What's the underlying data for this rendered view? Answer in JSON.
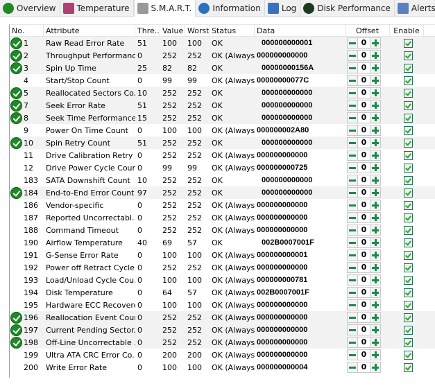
{
  "tabs": [
    {
      "label": "Overview",
      "icon": "check-circle-icon",
      "color": "#1e8a26"
    },
    {
      "label": "Temperature",
      "icon": "thermometer-icon",
      "color": "#b04070"
    },
    {
      "label": "S.M.A.R.T.",
      "icon": "disk-icon",
      "color": "#999999"
    },
    {
      "label": "Information",
      "icon": "info-icon",
      "color": "#2a6fc0"
    },
    {
      "label": "Log",
      "icon": "document-icon",
      "color": "#3a70c0"
    },
    {
      "label": "Disk Performance",
      "icon": "gauge-icon",
      "color": "#1e3a1e"
    },
    {
      "label": "Alerts",
      "icon": "alert-document-icon",
      "color": "#5a80c0"
    }
  ],
  "selected_tab": "S.M.A.R.T.",
  "columns": [
    "No.",
    "Attribute",
    "Thre...",
    "Value",
    "Worst",
    "Status",
    "Data",
    "Offset",
    "Enable"
  ],
  "rows": [
    {
      "ok": true,
      "no": "1",
      "attr": "Raw Read Error Rate",
      "thr": "51",
      "value": "100",
      "worst": "100",
      "status": "OK",
      "data": "000000000001",
      "offset": "0"
    },
    {
      "ok": true,
      "no": "2",
      "attr": "Throughput Performance",
      "thr": "0",
      "value": "252",
      "worst": "252",
      "status": "OK (Always...",
      "data": "000000000000",
      "offset": "0"
    },
    {
      "ok": true,
      "no": "3",
      "attr": "Spin Up Time",
      "thr": "25",
      "value": "82",
      "worst": "82",
      "status": "OK",
      "data": "00000000156A",
      "offset": "0"
    },
    {
      "ok": false,
      "no": "4",
      "attr": "Start/Stop Count",
      "thr": "0",
      "value": "99",
      "worst": "99",
      "status": "OK (Always...",
      "data": "00000000077C",
      "offset": "0"
    },
    {
      "ok": true,
      "no": "5",
      "attr": "Reallocated Sectors Co...",
      "thr": "10",
      "value": "252",
      "worst": "252",
      "status": "OK",
      "data": "000000000000",
      "offset": "0"
    },
    {
      "ok": true,
      "no": "7",
      "attr": "Seek Error Rate",
      "thr": "51",
      "value": "252",
      "worst": "252",
      "status": "OK",
      "data": "000000000000",
      "offset": "0"
    },
    {
      "ok": true,
      "no": "8",
      "attr": "Seek Time Performance",
      "thr": "15",
      "value": "252",
      "worst": "252",
      "status": "OK",
      "data": "000000000000",
      "offset": "0"
    },
    {
      "ok": false,
      "no": "9",
      "attr": "Power On Time Count",
      "thr": "0",
      "value": "100",
      "worst": "100",
      "status": "OK (Always...",
      "data": "000000002A80",
      "offset": "0"
    },
    {
      "ok": true,
      "no": "10",
      "attr": "Spin Retry Count",
      "thr": "51",
      "value": "252",
      "worst": "252",
      "status": "OK",
      "data": "000000000000",
      "offset": "0"
    },
    {
      "ok": false,
      "no": "11",
      "attr": "Drive Calibration Retry ...",
      "thr": "0",
      "value": "252",
      "worst": "252",
      "status": "OK (Always...",
      "data": "000000000000",
      "offset": "0"
    },
    {
      "ok": false,
      "no": "12",
      "attr": "Drive Power Cycle Count",
      "thr": "0",
      "value": "99",
      "worst": "99",
      "status": "OK (Always...",
      "data": "000000000725",
      "offset": "0"
    },
    {
      "ok": false,
      "no": "183",
      "attr": "SATA Downshift Count",
      "thr": "10",
      "value": "252",
      "worst": "252",
      "status": "OK",
      "data": "000000000000",
      "offset": "0"
    },
    {
      "ok": true,
      "no": "184",
      "attr": "End-to-End Error Count",
      "thr": "97",
      "value": "252",
      "worst": "252",
      "status": "OK",
      "data": "000000000000",
      "offset": "0"
    },
    {
      "ok": false,
      "no": "186",
      "attr": "Vendor-specific",
      "thr": "0",
      "value": "252",
      "worst": "252",
      "status": "OK (Always...",
      "data": "000000000000",
      "offset": "0"
    },
    {
      "ok": false,
      "no": "187",
      "attr": "Reported Uncorrectabl...",
      "thr": "0",
      "value": "252",
      "worst": "252",
      "status": "OK (Always...",
      "data": "000000000000",
      "offset": "0"
    },
    {
      "ok": false,
      "no": "188",
      "attr": "Command Timeout",
      "thr": "0",
      "value": "252",
      "worst": "252",
      "status": "OK (Always...",
      "data": "000000000000",
      "offset": "0"
    },
    {
      "ok": false,
      "no": "190",
      "attr": "Airflow Temperature",
      "thr": "40",
      "value": "69",
      "worst": "57",
      "status": "OK",
      "data": "002B0007001F",
      "offset": "0"
    },
    {
      "ok": false,
      "no": "191",
      "attr": "G-Sense Error Rate",
      "thr": "0",
      "value": "100",
      "worst": "100",
      "status": "OK (Always...",
      "data": "000000000001",
      "offset": "0"
    },
    {
      "ok": false,
      "no": "192",
      "attr": "Power off Retract Cycle ...",
      "thr": "0",
      "value": "252",
      "worst": "252",
      "status": "OK (Always...",
      "data": "000000000000",
      "offset": "0"
    },
    {
      "ok": false,
      "no": "193",
      "attr": "Load/Unload Cycle Cou...",
      "thr": "0",
      "value": "100",
      "worst": "100",
      "status": "OK (Always...",
      "data": "000000000781",
      "offset": "0"
    },
    {
      "ok": false,
      "no": "194",
      "attr": "Disk Temperature",
      "thr": "0",
      "value": "64",
      "worst": "57",
      "status": "OK (Always...",
      "data": "002B0007001F",
      "offset": "0"
    },
    {
      "ok": false,
      "no": "195",
      "attr": "Hardware ECC Recovered",
      "thr": "0",
      "value": "100",
      "worst": "100",
      "status": "OK (Always...",
      "data": "000000000000",
      "offset": "0"
    },
    {
      "ok": true,
      "no": "196",
      "attr": "Reallocation Event Count",
      "thr": "0",
      "value": "252",
      "worst": "252",
      "status": "OK (Always...",
      "data": "000000000000",
      "offset": "0"
    },
    {
      "ok": true,
      "no": "197",
      "attr": "Current Pending Sector...",
      "thr": "0",
      "value": "252",
      "worst": "252",
      "status": "OK (Always...",
      "data": "000000000000",
      "offset": "0"
    },
    {
      "ok": true,
      "no": "198",
      "attr": "Off-Line Uncorrectable ...",
      "thr": "0",
      "value": "252",
      "worst": "252",
      "status": "OK (Always...",
      "data": "000000000000",
      "offset": "0"
    },
    {
      "ok": false,
      "no": "199",
      "attr": "Ultra ATA CRC Error Co...",
      "thr": "0",
      "value": "200",
      "worst": "200",
      "status": "OK (Always...",
      "data": "000000000000",
      "offset": "0"
    },
    {
      "ok": false,
      "no": "200",
      "attr": "Write Error Rate",
      "thr": "0",
      "value": "100",
      "worst": "100",
      "status": "OK (Always...",
      "data": "000000000004",
      "offset": "0"
    }
  ]
}
